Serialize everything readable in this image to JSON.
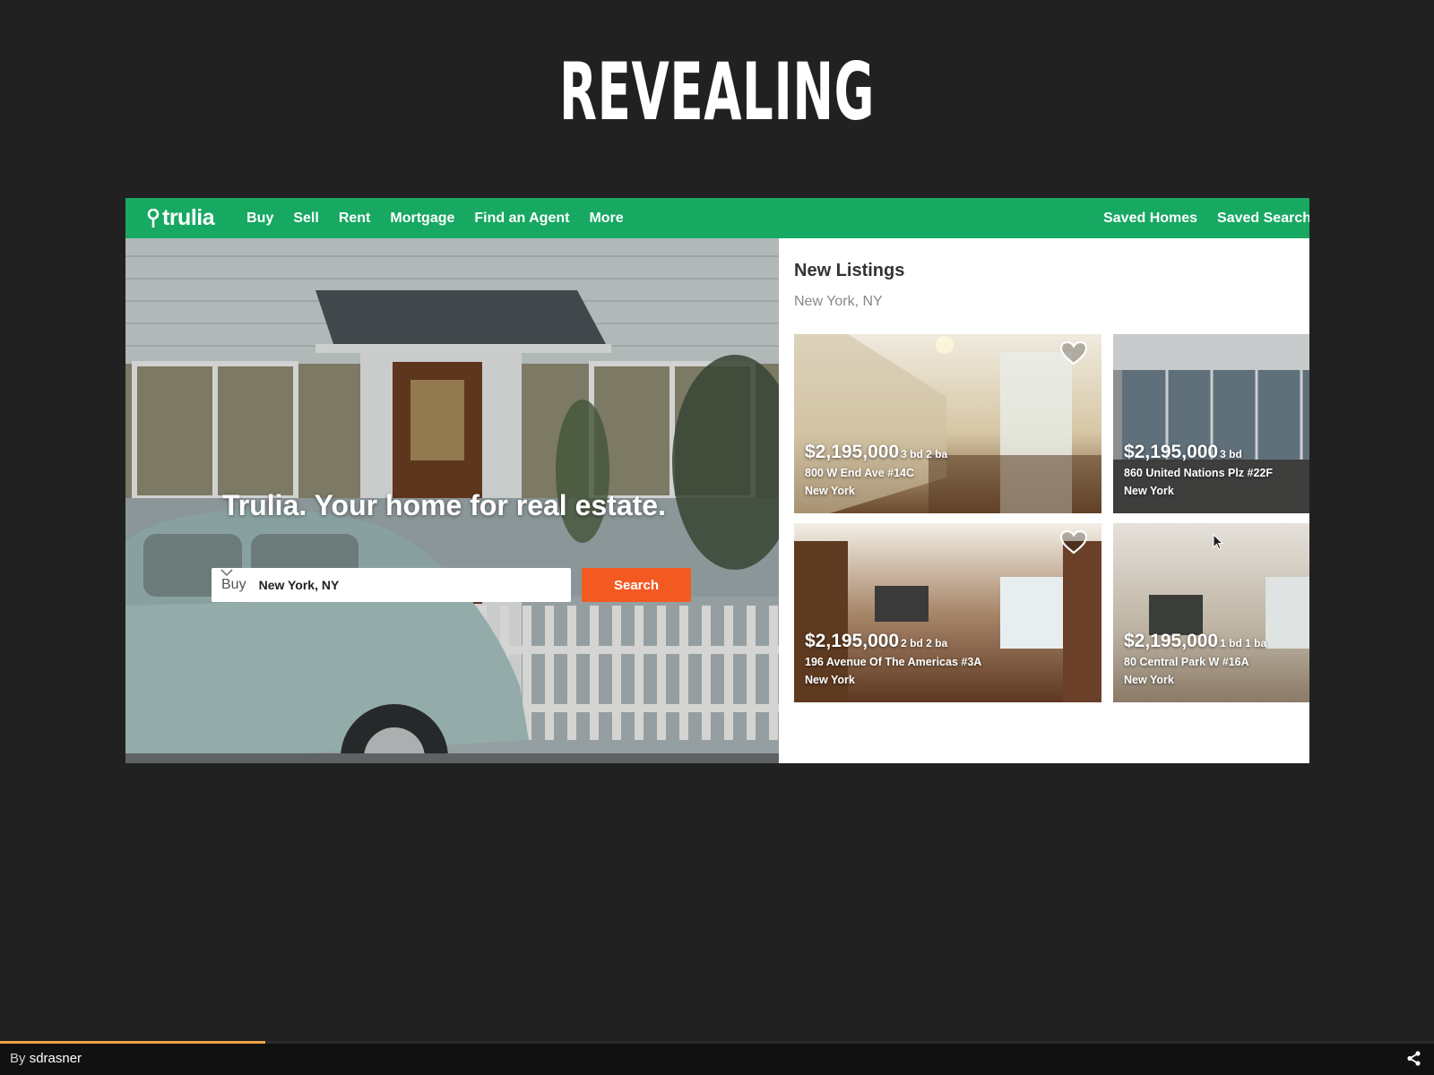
{
  "slide": {
    "title": "REVEALING"
  },
  "site": {
    "logo": "trulia",
    "nav": [
      "Buy",
      "Sell",
      "Rent",
      "Mortgage",
      "Find an Agent",
      "More"
    ],
    "nav_right": [
      "Saved Homes",
      "Saved Search"
    ],
    "brand_color": "#17a862"
  },
  "hero": {
    "tagline": "Trulia. Your home for real estate.",
    "search": {
      "type": "Buy",
      "value": "New York, NY",
      "button": "Search",
      "button_color": "#f35a22"
    }
  },
  "listings": {
    "title": "New Listings",
    "location": "New York, NY",
    "cards": [
      {
        "price": "$2,195,000",
        "beds": "3 bd 2 ba",
        "address": "800 W End Ave #14C",
        "city": "New York"
      },
      {
        "price": "$2,195,000",
        "beds": "3 bd",
        "address": "860 United Nations Plz #22F",
        "city": "New York"
      },
      {
        "price": "$2,195,000",
        "beds": "2 bd 2 ba",
        "address": "196 Avenue Of The Americas #3A",
        "city": "New York"
      },
      {
        "price": "$2,195,000",
        "beds": "1 bd 1 ba",
        "address": "80 Central Park W #16A",
        "city": "New York"
      }
    ]
  },
  "footer": {
    "by_label": "By",
    "author": "sdrasner",
    "progress": 0.185,
    "accent_color": "#f0a24a"
  }
}
